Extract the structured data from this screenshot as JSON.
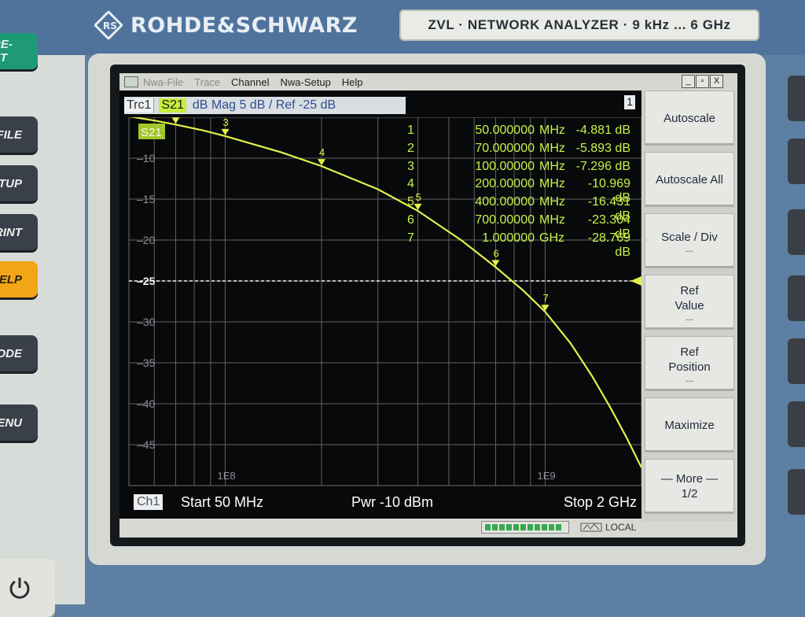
{
  "brand": {
    "name": "ROHDE&SCHWARZ",
    "model": "ZVL  ·  NETWORK ANALYZER  ·  9 kHz ... 6 GHz"
  },
  "hardware_buttons": [
    "PRE-SET",
    "FILE",
    "SETUP",
    "PRINT",
    "HELP",
    "MODE",
    "MENU"
  ],
  "menu": {
    "items": [
      "Nwa-File",
      "Trace",
      "Channel",
      "Nwa-Setup",
      "Help"
    ],
    "window_buttons": [
      "_",
      "▫",
      "X"
    ]
  },
  "trace_header": {
    "trace": "Trc1",
    "param": "S21",
    "desc": "dB Mag  5 dB /  Ref -25 dB",
    "channel_number": "1"
  },
  "markers": [
    {
      "n": "1",
      "freq": "50.000000",
      "unit": "MHz",
      "value": "-4.881 dB"
    },
    {
      "n": "2",
      "freq": "70.000000",
      "unit": "MHz",
      "value": "-5.893 dB"
    },
    {
      "n": "3",
      "freq": "100.00000",
      "unit": "MHz",
      "value": "-7.296 dB"
    },
    {
      "n": "4",
      "freq": "200.00000",
      "unit": "MHz",
      "value": "-10.969 dB"
    },
    {
      "n": "5",
      "freq": "400.00000",
      "unit": "MHz",
      "value": "-16.431 dB"
    },
    {
      "n": "6",
      "freq": "700.00000",
      "unit": "MHz",
      "value": "-23.304 dB"
    },
    {
      "n": "7",
      "freq": "1.000000",
      "unit": "GHz",
      "value": "-28.769 dB"
    }
  ],
  "chart_data": {
    "type": "line",
    "x_scale": "log",
    "xlim_mhz": [
      50,
      2000
    ],
    "ylim": [
      -50,
      -5
    ],
    "y_ticks": [
      "-10",
      "-15",
      "-20",
      "-25",
      "-30",
      "-35",
      "-40",
      "-45"
    ],
    "x_tick_labels": [
      "1E8",
      "1E9"
    ],
    "x_tick_values_mhz": [
      100,
      1000
    ],
    "ref_level": -25,
    "series": [
      {
        "label": "S21",
        "color": "#e4f04a",
        "x_mhz": [
          50,
          60,
          70,
          85,
          100,
          150,
          200,
          300,
          400,
          550,
          700,
          850,
          1000,
          1200,
          1400,
          1600,
          1800,
          2000
        ],
        "y": [
          -4.881,
          -5.4,
          -5.893,
          -6.6,
          -7.296,
          -9.3,
          -10.969,
          -13.8,
          -16.431,
          -20.1,
          -23.304,
          -26.1,
          -28.769,
          -32.6,
          -36.6,
          -40.5,
          -44.2,
          -47.8
        ]
      }
    ],
    "marker_points": [
      {
        "label": "1",
        "x_mhz": 50,
        "y": -4.881
      },
      {
        "label": "2",
        "x_mhz": 70,
        "y": -5.893
      },
      {
        "label": "3",
        "x_mhz": 100,
        "y": -7.296
      },
      {
        "label": "4",
        "x_mhz": 200,
        "y": -10.969
      },
      {
        "label": "5",
        "x_mhz": 400,
        "y": -16.431
      },
      {
        "label": "6",
        "x_mhz": 700,
        "y": -23.304
      },
      {
        "label": "7",
        "x_mhz": 1000,
        "y": -28.769
      }
    ],
    "trace_tag": "S21",
    "grid": true
  },
  "status": {
    "channel": "Ch1",
    "start": "Start  50 MHz",
    "power": "Pwr  -10 dBm",
    "stop": "Stop  2 GHz",
    "remote": "LOCAL"
  },
  "softkeys": [
    {
      "label": "Autoscale",
      "dots": ""
    },
    {
      "label": "Autoscale All",
      "dots": ""
    },
    {
      "label": "Scale / Div",
      "dots": "..."
    },
    {
      "label": "Ref Value",
      "dots": "..."
    },
    {
      "label": "Ref Position",
      "dots": "..."
    },
    {
      "label": "Maximize",
      "dots": ""
    },
    {
      "label": "— More — 1/2",
      "dots": ""
    }
  ]
}
